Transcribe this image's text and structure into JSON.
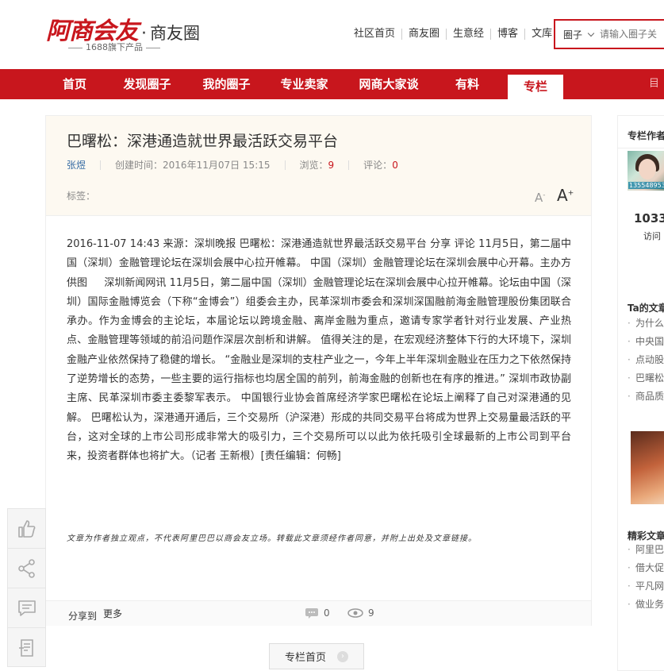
{
  "header": {
    "logo_main": "阿商会友",
    "logo_sub": "商友圈",
    "logo_tagline": "1688旗下产品",
    "top_links": [
      "社区首页",
      "商友圈",
      "生意经",
      "博客",
      "文库"
    ],
    "search": {
      "selected": "圈子",
      "placeholder": "请输入圈子关"
    }
  },
  "nav": {
    "items": [
      "首页",
      "发现圈子",
      "我的圈子",
      "专业卖家",
      "网商大家谈",
      "有料",
      "专栏"
    ],
    "active": "专栏",
    "right_text": "目"
  },
  "article": {
    "title": "巴曙松：深港通造就世界最活跃交易平台",
    "author": "张煜",
    "created_label": "创建时间：",
    "created": "2016年11月07日 15:15",
    "views_label": "浏览：",
    "views": "9",
    "comments_label": "评论：",
    "comments": "0",
    "tags_label": "标签：",
    "font_small": "A",
    "font_large": "A",
    "body": "2016-11-07 14:43 来源：深圳晚报 巴曙松：深港通造就世界最活跃交易平台 分享 评论 11月5日，第二届中国（深圳）金融管理论坛在深圳会展中心拉开帷幕。 中国（深圳）金融管理论坛在深圳会展中心开幕。主办方供图 　 深圳新闻网讯 11月5日，第二届中国（深圳）金融管理论坛在深圳会展中心拉开帷幕。论坛由中国（深圳）国际金融博览会（下称“金博会”）组委会主办，民革深圳市委会和深圳深国融前海金融管理股份集团联合承办。作为金博会的主论坛，本届论坛以跨境金融、离岸金融为重点，邀请专家学者针对行业发展、产业热点、金融管理等领域的前沿问题作深层次剖析和讲解。 值得关注的是，在宏观经济整体下行的大环境下，深圳金融产业依然保持了稳健的增长。 “金融业是深圳的支柱产业之一，今年上半年深圳金融业在压力之下依然保持了逆势增长的态势，一些主要的运行指标也均居全国的前列，前海金融的创新也在有序的推进。” 深圳市政协副主席、民革深圳市委主委黎军表示。 中国银行业协会首席经济学家巴曙松在论坛上阐释了自己对深港通的见解。 巴曙松认为，深港通开通后，三个交易所（沪深港）形成的共同交易平台将成为世界上交易量最活跃的平台，这对全球的上市公司形成非常大的吸引力，三个交易所可以以此为依托吸引全球最新的上市公司到平台来，投资者群体也将扩大。（记者 王新根）[责任编辑：何畅]",
    "disclaimer": "文章为作者独立观点，不代表阿里巴巴以商会友立场。转载此文章须经作者同意，并附上出处及文章链接。",
    "share_label": "分享到",
    "share_more": "更多",
    "footer_comments": "0",
    "footer_views": "9",
    "column_home_button": "专栏首页"
  },
  "sidebar": {
    "heading": "专栏作者",
    "avatar_phone": "13554895399",
    "count": "1033",
    "visit_label": "访问",
    "section_title": "Ta的文章",
    "articles": [
      "为什么",
      "中央国",
      "点动股",
      "巴曙松",
      "商品质"
    ],
    "section2_title": "精彩文章",
    "featured": [
      "阿里巴",
      "借大促",
      "平凡网",
      "做业务"
    ]
  },
  "colors": {
    "brand_red": "#c8161d",
    "head_bg": "#fdf9f1"
  }
}
